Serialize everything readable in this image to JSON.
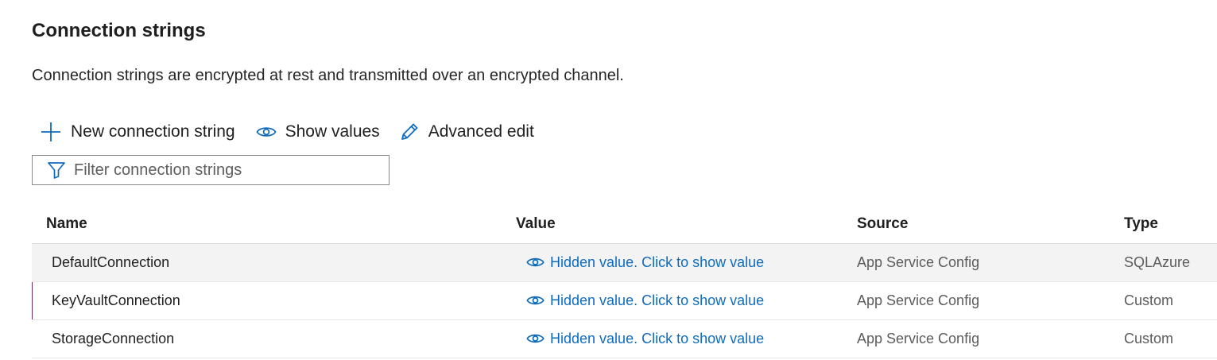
{
  "section": {
    "title": "Connection strings",
    "description": "Connection strings are encrypted at rest and transmitted over an encrypted channel."
  },
  "toolbar": {
    "new_label": "New connection string",
    "new_icon": "plus-icon",
    "show_label": "Show values",
    "show_icon": "eye-icon",
    "advanced_label": "Advanced edit",
    "advanced_icon": "pencil-icon"
  },
  "filter": {
    "placeholder": "Filter connection strings",
    "value": "",
    "icon": "filter-icon"
  },
  "table": {
    "columns": {
      "name": "Name",
      "value": "Value",
      "source": "Source",
      "type": "Type"
    },
    "rows": [
      {
        "name": "DefaultConnection",
        "value": "Hidden value. Click to show value",
        "source": "App Service Config",
        "type": "SQLAzure"
      },
      {
        "name": "KeyVaultConnection",
        "value": "Hidden value. Click to show value",
        "source": "App Service Config",
        "type": "Custom"
      },
      {
        "name": "StorageConnection",
        "value": "Hidden value. Click to show value",
        "source": "App Service Config",
        "type": "Custom"
      }
    ]
  },
  "colors": {
    "link": "#0f6cbd",
    "selected_row": "#f3f3f3",
    "focus_indicator": "#6b2c5f"
  }
}
